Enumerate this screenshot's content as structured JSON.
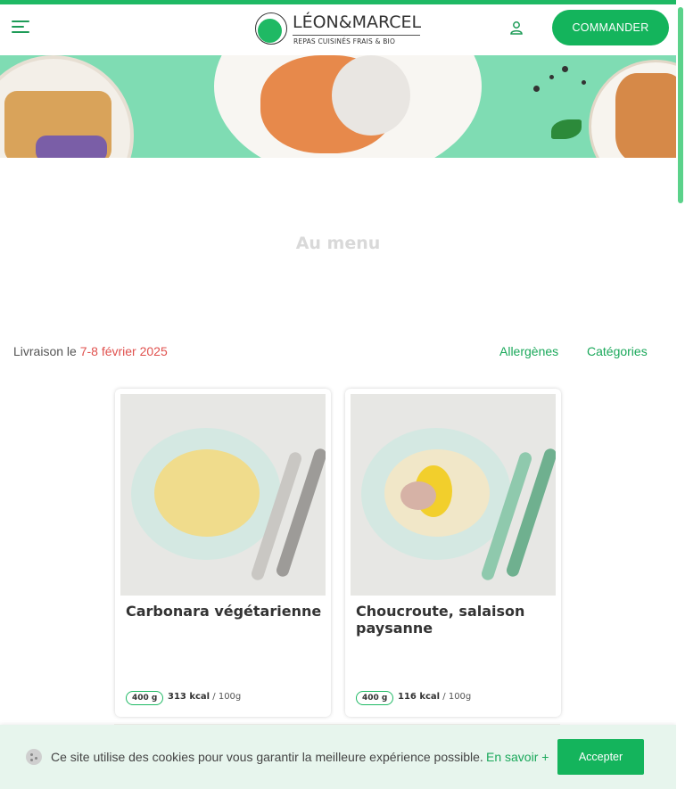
{
  "header": {
    "menu_icon": "hamburger-menu-icon",
    "logo": {
      "title": "LÉON&MARCEL",
      "subtitle": "REPAS CUISINÉS FRAIS & BIO"
    },
    "user_icon": "user-icon",
    "order_button": "COMMANDER"
  },
  "colors": {
    "brand_green": "#14b45c",
    "hero_mint": "#7fdcb3",
    "date_red": "#e0514e"
  },
  "menu_section": {
    "title": "Au menu",
    "delivery_label": "Livraison le ",
    "delivery_date": "7-8 février 2025",
    "filters": [
      "Allergènes",
      "Catégories"
    ]
  },
  "dishes": [
    {
      "name": "Carbonara végétarienne",
      "weight": "400 g",
      "kcal": "313 kcal",
      "per": " / 100g"
    },
    {
      "name": "Choucroute, salaison paysanne",
      "weight": "400 g",
      "kcal": "116 kcal",
      "per": " / 100g"
    }
  ],
  "cookie_banner": {
    "icon": "cookie-icon",
    "text": "Ce site utilise des cookies pour vous garantir la meilleure expérience possible.",
    "learn_more": "En savoir +",
    "accept": "Accepter"
  }
}
